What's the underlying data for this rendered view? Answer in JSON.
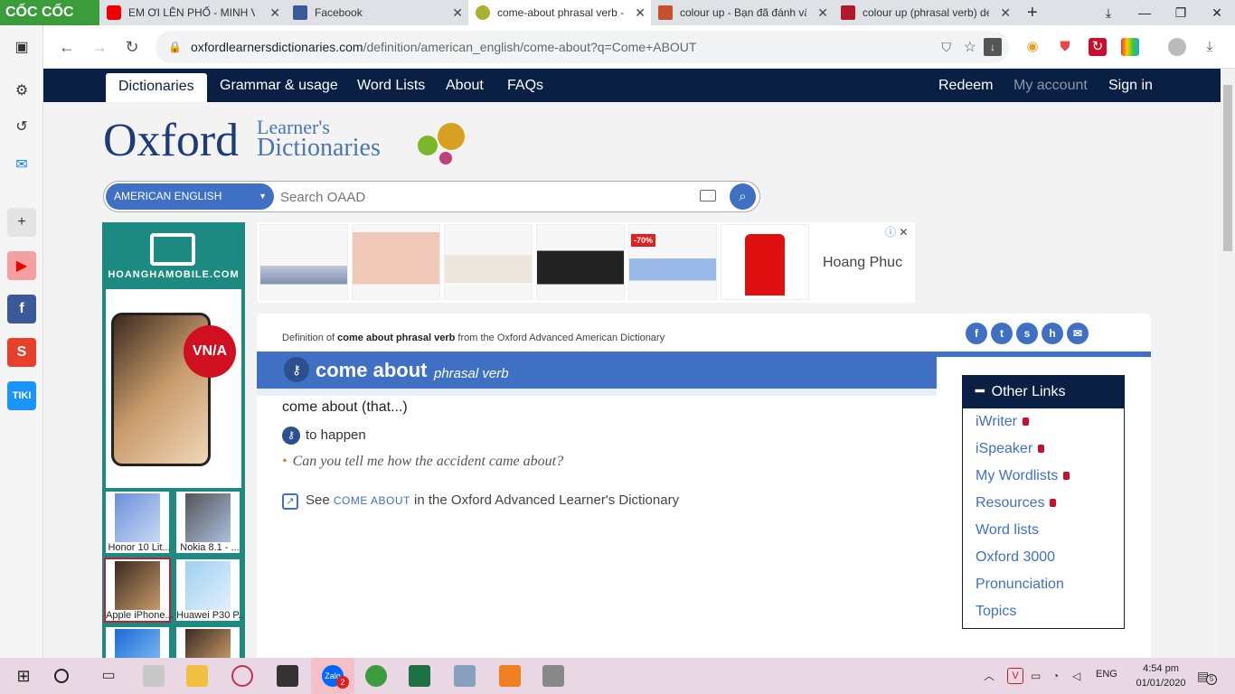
{
  "browser": {
    "brand": "CỐC CỐC",
    "tabs": [
      {
        "label": "EM ƠI LÊN PHỐ - MINH VU",
        "icon": "youtube-icon"
      },
      {
        "label": "Facebook",
        "icon": "facebook-icon"
      },
      {
        "label": "come-about phrasal verb -",
        "icon": "oxford-icon",
        "active": true
      },
      {
        "label": "colour up - Bạn đã đánh vã",
        "icon": "cambridge-icon"
      },
      {
        "label": "colour up (phrasal verb) def",
        "icon": "merriam-icon"
      }
    ],
    "new_tab": "+",
    "url_host": "oxfordlearnersdictionaries.com",
    "url_path": "/definition/american_english/come-about?q=Come+ABOUT"
  },
  "nav": {
    "items": [
      "Dictionaries",
      "Grammar & usage",
      "Word Lists",
      "About",
      "FAQs"
    ],
    "right": [
      "Redeem",
      "My account",
      "Sign in"
    ]
  },
  "logo": {
    "main": "Oxford",
    "line1": "Learner's",
    "line2": "Dictionaries"
  },
  "search": {
    "language": "AMERICAN ENGLISH",
    "placeholder": "Search OAAD"
  },
  "side_ad": {
    "brand": "HOANGHAMOBILE.COM",
    "badge": "VN/A",
    "products": [
      "Honor 10 Lit...",
      "Nokia 8.1 - ...",
      "Apple iPhone...",
      "Huawei P30 P..."
    ]
  },
  "top_ad": {
    "brand": "Hoang Phuc",
    "discount": "-70%"
  },
  "entry": {
    "source_prefix": "Definition of ",
    "source_term": "come about phrasal verb",
    "source_suffix": " from the Oxford Advanced American Dictionary",
    "headword": "come about",
    "pos": "phrasal verb",
    "phrase": "come about (that...)",
    "definition": "to happen",
    "example": "Can you tell me how the accident came about?",
    "see_prefix": "See ",
    "see_term": "COME ABOUT",
    "see_suffix": " in the Oxford Advanced Learner's Dictionary"
  },
  "other_links": {
    "title": "Other Links",
    "items": [
      {
        "label": "iWriter",
        "locked": true
      },
      {
        "label": "iSpeaker",
        "locked": true
      },
      {
        "label": "My Wordlists",
        "locked": true
      },
      {
        "label": "Resources",
        "locked": true
      },
      {
        "label": "Word lists",
        "locked": false
      },
      {
        "label": "Oxford 3000",
        "locked": false
      },
      {
        "label": "Pronunciation",
        "locked": false
      },
      {
        "label": "Topics",
        "locked": false
      }
    ]
  },
  "taskbar": {
    "language": "ENG",
    "time": "4:54 pm",
    "date": "01/01/2020",
    "notifications": "5",
    "zalo_badge": "2"
  },
  "colors": {
    "navy": "#0a1f44",
    "blue": "#3f70c4",
    "teal": "#1c8a80"
  }
}
